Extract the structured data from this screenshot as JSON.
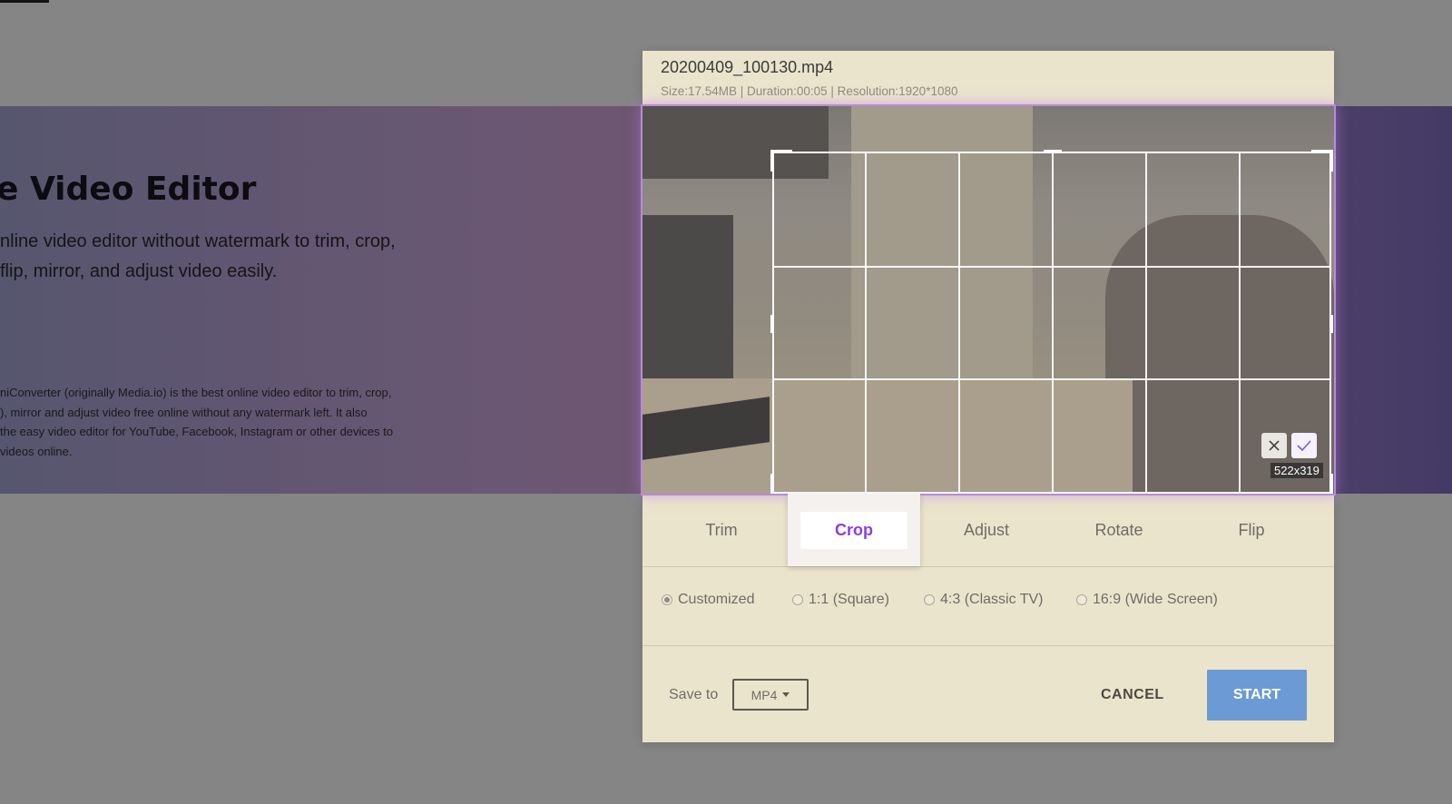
{
  "hero": {
    "title": "e Video Editor",
    "subtitle": "nline video editor without watermark to trim, crop,\n flip, mirror, and adjust video easily.",
    "description": "niConverter (originally Media.io) is the best online video editor to trim, crop,\n), mirror and adjust video free online without any watermark left. It also\nthe easy video editor for YouTube, Facebook, Instagram or other devices to\nvideos online."
  },
  "dialog": {
    "file_name": "20200409_100130.mp4",
    "file_meta": "Size:17.54MB | Duration:00:05 | Resolution:1920*1080",
    "crop_size": "522x319",
    "tabs": [
      {
        "label": "Trim"
      },
      {
        "label": "Crop",
        "active": true
      },
      {
        "label": "Adjust"
      },
      {
        "label": "Rotate"
      },
      {
        "label": "Flip"
      }
    ],
    "ratios": [
      {
        "label": "Customized",
        "selected": true
      },
      {
        "label": "1:1 (Square)",
        "selected": false
      },
      {
        "label": "4:3 (Classic TV)",
        "selected": false
      },
      {
        "label": "16:9 (Wide Screen)",
        "selected": false
      }
    ],
    "save_to_label": "Save to",
    "format_value": "MP4",
    "cancel_label": "CANCEL",
    "start_label": "START"
  },
  "colors": {
    "accent_purple": "#8a3fe0",
    "start_button": "#6c9ad4",
    "dialog_bg": "#ebe4cc"
  }
}
